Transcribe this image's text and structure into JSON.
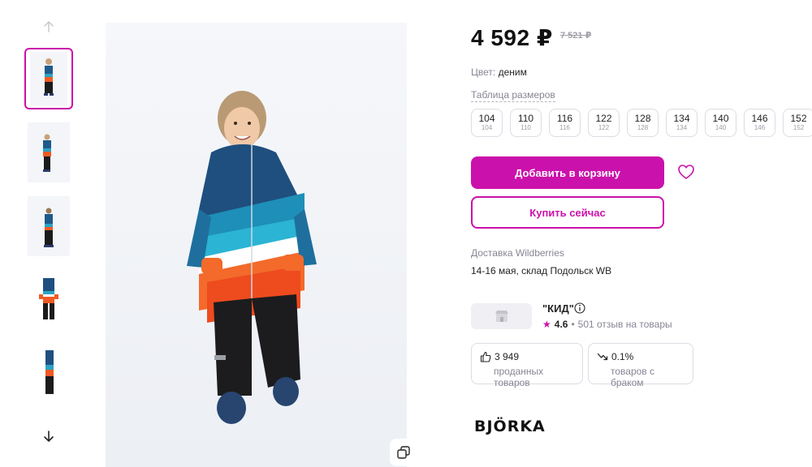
{
  "gallery": {
    "thumbnails": [
      {
        "label": "photo-1",
        "active": true
      },
      {
        "label": "photo-2",
        "active": false
      },
      {
        "label": "photo-3",
        "active": false
      },
      {
        "label": "photo-4",
        "active": false
      },
      {
        "label": "photo-5",
        "active": false
      }
    ],
    "icons": {
      "up": "arrow-up-icon",
      "down": "arrow-down-icon",
      "copy": "copy-icon"
    }
  },
  "product": {
    "price": "4 592 ₽",
    "old_price": "7 521 ₽",
    "color_label": "Цвет:",
    "color_value": "деним",
    "size_table_link": "Таблица размеров",
    "sizes": [
      {
        "size": "104",
        "sub": "104"
      },
      {
        "size": "110",
        "sub": "110"
      },
      {
        "size": "116",
        "sub": "116"
      },
      {
        "size": "122",
        "sub": "122"
      },
      {
        "size": "128",
        "sub": "128"
      },
      {
        "size": "134",
        "sub": "134"
      },
      {
        "size": "140",
        "sub": "140"
      },
      {
        "size": "146",
        "sub": "146"
      },
      {
        "size": "152",
        "sub": "152"
      }
    ],
    "add_to_cart": "Добавить в корзину",
    "buy_now": "Купить сейчас"
  },
  "delivery": {
    "label": "Доставка Wildberries",
    "date": "14-16 мая, склад Подольск WB"
  },
  "seller": {
    "name": "\"КИД\"",
    "rating": "4.6",
    "reviews": "501 отзыв на товары",
    "separator": "•"
  },
  "stats": {
    "sold_count": "3 949",
    "sold_label": "проданных товаров",
    "defect_rate": "0.1%",
    "defect_label": "товаров с браком"
  },
  "brand": {
    "name": "BJÖRKA"
  },
  "colors": {
    "accent": "#cb11ab",
    "muted": "#868695",
    "border": "#dcdce4"
  }
}
